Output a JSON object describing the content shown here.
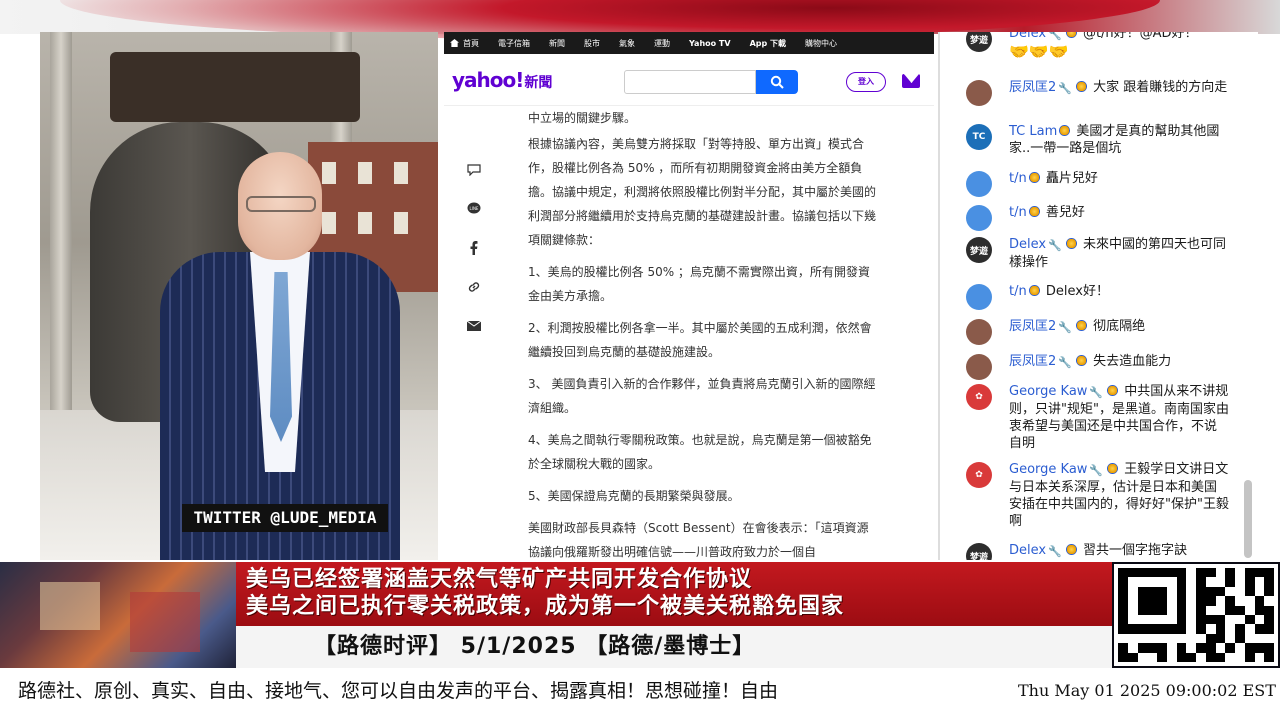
{
  "video": {
    "twitter_tag": "TWITTER  @LUDE_MEDIA"
  },
  "yahoo": {
    "nav": [
      "首頁",
      "電子信箱",
      "新聞",
      "股市",
      "氣象",
      "運動",
      "Yahoo TV",
      "App 下載",
      "購物中心"
    ],
    "logo": "yahoo!",
    "logo_suffix": "新聞",
    "search_placeholder": "",
    "login_label": "登入",
    "share_icons": [
      "comment-icon",
      "line-icon",
      "facebook-icon",
      "link-icon",
      "mail-icon"
    ],
    "paragraphs": [
      "中立場的關鍵步驟。",
      "根據協議內容，美烏雙方將採取「對等持股、單方出資」模式合作，股權比例各為 50% ，而所有初期開發資金將由美方全額負擔。協議中規定，利潤將依照股權比例對半分配，其中屬於美國的利潤部分將繼續用於支持烏克蘭的基礎建設計畫。協議包括以下幾項關鍵條款：",
      "1、美烏的股權比例各 50% ；烏克蘭不需實際出資，所有開發資金由美方承擔。",
      "2、利潤按股權比例各拿一半。其中屬於美國的五成利潤，依然會繼續投回到烏克蘭的基礎設施建設。",
      "3、 美國負責引入新的合作夥伴，並負責將烏克蘭引入新的國際經濟組織。",
      "4、美烏之間執行零關稅政策。也就是說，烏克蘭是第一個被豁免於全球關稅大戰的國家。",
      "5、美國保證烏克蘭的長期繁榮與發展。",
      "美國財政部長貝森特（Scott Bessent）在會後表示：「這項資源協議向俄羅斯發出明確信號——川普政府致力於一個自"
    ]
  },
  "chat": {
    "messages": [
      {
        "author": "Delex",
        "text": "@t/n好！@AD好！",
        "avatar_color": "#2d2d2d",
        "avatar_text": "梦遊",
        "extra": "🤝🤝🤝"
      },
      {
        "author": "辰凤匡2",
        "text": "大家 跟着賺钱的方向走",
        "avatar_color": "#8a5a4a",
        "avatar_text": ""
      },
      {
        "author": "TC Lam",
        "text": "美國才是真的幫助其他國家..一帶一路是個坑",
        "avatar_color": "#1c6fb8",
        "avatar_text": "TC"
      },
      {
        "author": "t/n",
        "text": "矗片兒好",
        "avatar_color": "#4a90e2",
        "avatar_text": ""
      },
      {
        "author": "t/n",
        "text": "善兒好",
        "avatar_color": "#4a90e2",
        "avatar_text": ""
      },
      {
        "author": "Delex",
        "text": "未來中國的第四天也可同樣操作",
        "avatar_color": "#2d2d2d",
        "avatar_text": "梦遊"
      },
      {
        "author": "t/n",
        "text": "Delex好！",
        "avatar_color": "#4a90e2",
        "avatar_text": ""
      },
      {
        "author": "辰凤匡2",
        "text": "彻底隔绝",
        "avatar_color": "#8a5a4a",
        "avatar_text": ""
      },
      {
        "author": "辰凤匡2",
        "text": "失去造血能力",
        "avatar_color": "#8a5a4a",
        "avatar_text": ""
      },
      {
        "author": "George Kaw",
        "text": "中共国从来不讲规则，只讲\"规矩\"，是黑道。南南国家由衷希望与美国还是中共国合作，不说自明",
        "avatar_color": "#d93a3a",
        "avatar_text": "✿"
      },
      {
        "author": "George Kaw",
        "text": "王毅学日文讲日文与日本关系深厚，估计是日本和美国安插在中共国内的，得好好\"保护\"王毅啊",
        "avatar_color": "#d93a3a",
        "avatar_text": "✿"
      },
      {
        "author": "Delex",
        "text": "習共一個字拖字訣",
        "avatar_color": "#2d2d2d",
        "avatar_text": "梦遊"
      }
    ]
  },
  "lower_third": {
    "headline_1": "美乌已经签署涵盖天然气等矿产共同开发合作协议",
    "headline_2": "美乌之间已执行零关税政策，成为第一个被美关税豁免国家",
    "program": "【路德时评】 5/1/2025 【路德/墨博士】"
  },
  "ticker": {
    "text": "路德社、原创、真实、自由、接地气、您可以自由发声的平台、揭露真相！思想碰撞！自由",
    "datetime": "Thu May 01 2025 09:00:02 EST"
  }
}
